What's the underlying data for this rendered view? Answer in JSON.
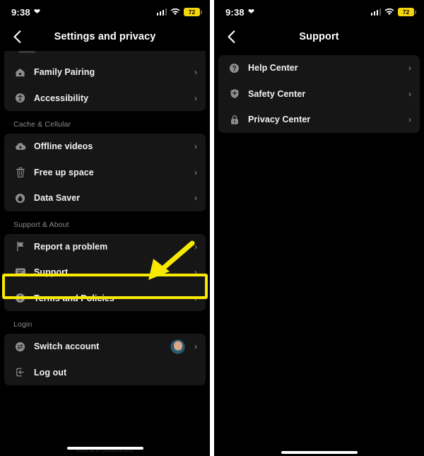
{
  "left_phone": {
    "status_bar": {
      "time": "9:38",
      "heart_icon": "heart-icon",
      "cellular_icon": "signal-bars-icon",
      "wifi_icon": "wifi-icon",
      "battery_level": "72",
      "battery_color": "#f5d60a"
    },
    "nav": {
      "back_icon": "chevron-left-icon",
      "title": "Settings and privacy"
    },
    "groups": [
      {
        "rows": [
          {
            "icon": "home-icon",
            "label": "Family Pairing",
            "chevron": "›"
          },
          {
            "icon": "accessibility-icon",
            "label": "Accessibility",
            "chevron": "›"
          }
        ]
      }
    ],
    "section_cache": {
      "header": "Cache & Cellular",
      "rows": [
        {
          "icon": "cloud-download-icon",
          "label": "Offline videos",
          "chevron": "›"
        },
        {
          "icon": "trash-icon",
          "label": "Free up space",
          "chevron": "›"
        },
        {
          "icon": "data-saver-icon",
          "label": "Data Saver",
          "chevron": "›"
        }
      ]
    },
    "section_support": {
      "header": "Support & About",
      "rows": [
        {
          "icon": "flag-icon",
          "label": "Report a problem",
          "chevron": "›"
        },
        {
          "icon": "chat-bubble-icon",
          "label": "Support",
          "chevron": "›"
        },
        {
          "icon": "info-icon",
          "label": "Terms and Policies",
          "chevron": "›"
        }
      ]
    },
    "section_login": {
      "header": "Login",
      "rows": [
        {
          "icon": "switch-account-icon",
          "label": "Switch account",
          "chevron": "›"
        },
        {
          "icon": "logout-icon",
          "label": "Log out",
          "chevron": ""
        }
      ]
    },
    "version_text": "v30.2.0 (3020230)",
    "annotation": {
      "highlight_color": "#f7ea00",
      "highlight_target": "Support",
      "arrow_color": "#f7ea00"
    }
  },
  "right_phone": {
    "status_bar": {
      "time": "9:38",
      "heart_icon": "heart-icon",
      "cellular_icon": "signal-bars-icon",
      "wifi_icon": "wifi-icon",
      "battery_level": "72",
      "battery_color": "#f5d60a"
    },
    "nav": {
      "back_icon": "chevron-left-icon",
      "title": "Support"
    },
    "rows": [
      {
        "icon": "question-circle-icon",
        "label": "Help Center",
        "chevron": "›"
      },
      {
        "icon": "shield-icon",
        "label": "Safety Center",
        "chevron": "›"
      },
      {
        "icon": "lock-icon",
        "label": "Privacy Center",
        "chevron": "›"
      }
    ]
  }
}
